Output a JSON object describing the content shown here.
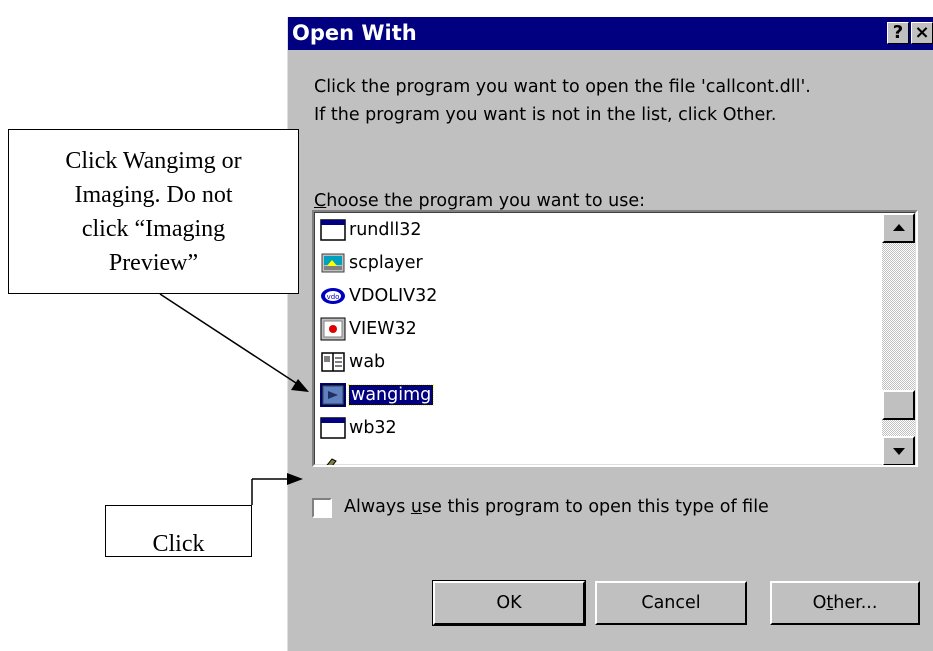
{
  "dialog": {
    "title": "Open With",
    "help_button": "?",
    "close_button": "×",
    "description_line1": "Click the program you want to open the file 'callcont.dll'.",
    "description_line2": "If the program you want is not in the list, click Other.",
    "choose_prefix": "C",
    "choose_rest": "hoose the program you want to use:",
    "programs": [
      {
        "label": "rundll32",
        "icon": "window-app-icon"
      },
      {
        "label": "scplayer",
        "icon": "scplayer-icon"
      },
      {
        "label": "VDOLIV32",
        "icon": "vdo-icon"
      },
      {
        "label": "VIEW32",
        "icon": "view-app-icon"
      },
      {
        "label": "wab",
        "icon": "address-book-icon"
      },
      {
        "label": "wangimg",
        "icon": "imaging-icon",
        "selected": true
      },
      {
        "label": "wb32",
        "icon": "window-app-icon"
      }
    ],
    "checkbox_pre": "Always ",
    "checkbox_u": "u",
    "checkbox_post": "se this program to open this type of file",
    "checkbox_checked": false,
    "buttons": {
      "ok": "OK",
      "cancel": "Cancel",
      "other_pre": "O",
      "other_u": "t",
      "other_post": "her..."
    }
  },
  "annotations": {
    "callout_top": [
      "Click Wangimg or",
      "Imaging.  Do not",
      "click “Imaging",
      "Preview”"
    ],
    "callout_bottom": "Click"
  },
  "colors": {
    "titlebar": "#000080",
    "dialog_face": "#c0c0c0",
    "selection": "#000080"
  }
}
